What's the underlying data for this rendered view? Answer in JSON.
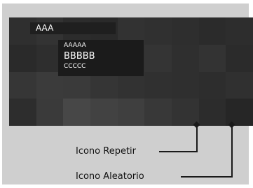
{
  "screen": {
    "top_label": "AAA",
    "info": {
      "line1": "AAAAA",
      "line2": "BBBBB",
      "line3": "CCCCC"
    },
    "mosaic_colors": [
      [
        "#2f2f2f",
        "#333333",
        "#2c2c2c",
        "#2a2a2a",
        "#323232",
        "#303030",
        "#2e2e2e",
        "#2b2b2b",
        "#2d2d2d"
      ],
      [
        "#2a2a2a",
        "#2e2e2e",
        "#252525",
        "#242424",
        "#303030",
        "#343434",
        "#2f2f2f",
        "#333333",
        "#2b2b2b"
      ],
      [
        "#363636",
        "#3b3b3b",
        "#3a3a3a",
        "#353535",
        "#323232",
        "#303030",
        "#2f2f2f",
        "#2d2d2d",
        "#303030"
      ],
      [
        "#2d2d2d",
        "#3a3a3a",
        "#474747",
        "#424242",
        "#3f3f3f",
        "#383838",
        "#333333",
        "#2c2c2c",
        "#262626"
      ]
    ]
  },
  "callouts": {
    "repeat_label": "Icono Repetir",
    "shuffle_label": "Icono Aleatorio"
  }
}
